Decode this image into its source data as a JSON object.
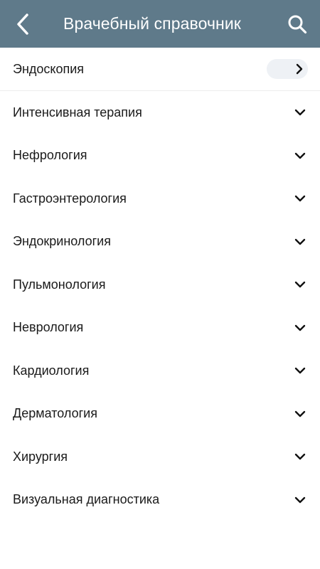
{
  "header": {
    "title": "Врачебный справочник",
    "back_icon": "chevron-left-icon",
    "search_icon": "search-icon",
    "background": "#5f7a8a"
  },
  "list": {
    "items": [
      {
        "label": "Эндоскопия",
        "icon": "chevron-right-icon",
        "selected": true
      },
      {
        "label": "Интенсивная терапия",
        "icon": "chevron-down-icon"
      },
      {
        "label": "Нефрология",
        "icon": "chevron-down-icon"
      },
      {
        "label": "Гастроэнтерология",
        "icon": "chevron-down-icon"
      },
      {
        "label": "Эндокринология",
        "icon": "chevron-down-icon"
      },
      {
        "label": "Пульмонология",
        "icon": "chevron-down-icon"
      },
      {
        "label": "Неврология",
        "icon": "chevron-down-icon"
      },
      {
        "label": "Кардиология",
        "icon": "chevron-down-icon"
      },
      {
        "label": "Дерматология",
        "icon": "chevron-down-icon"
      },
      {
        "label": "Хирургия",
        "icon": "chevron-down-icon"
      },
      {
        "label": "Визуальная диагностика",
        "icon": "chevron-down-icon"
      }
    ]
  }
}
